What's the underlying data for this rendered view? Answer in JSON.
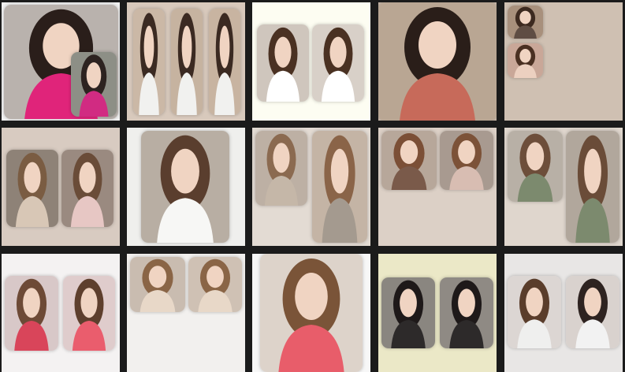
{
  "gallery": {
    "rows": [
      [
        {
          "bg": "#f2f2f2",
          "panels": [
            {
              "tone": "#b9b2ad",
              "accent": "#e0247a",
              "hair": "#2a1e1a"
            },
            {
              "tone": "#8d8f86",
              "accent": "#d12b82",
              "hair": "#2d2320"
            }
          ]
        },
        {
          "bg": "#d8c9bc",
          "panels": [
            {
              "tone": "#cbb8a6",
              "accent": "#f1f1ef",
              "hair": "#3b2a22"
            },
            {
              "tone": "#c6b3a0",
              "accent": "#f1f1ef",
              "hair": "#3b2a22"
            },
            {
              "tone": "#c8b4a1",
              "accent": "#f1f1ef",
              "hair": "#3b2a22"
            }
          ]
        },
        {
          "bg": "#fdfdf2",
          "panels": [
            {
              "tone": "#cfc6bd",
              "accent": "#ffffff",
              "hair": "#4a3122"
            },
            {
              "tone": "#d8d0c8",
              "accent": "#ffffff",
              "hair": "#4a3122"
            }
          ]
        },
        {
          "bg": "#c9b8a8",
          "panels": [
            {
              "tone": "#b9a693",
              "accent": "#c76a5a",
              "hair": "#2a1e19"
            }
          ]
        },
        {
          "bg": "#cfc0b2",
          "panels": [
            {
              "tone": "#a8907c",
              "accent": "#5f4d43",
              "hair": "#3d2a20"
            },
            {
              "tone": "#c9a798",
              "accent": "#ecd0c0",
              "hair": "#4a3022"
            }
          ]
        }
      ],
      [
        {
          "bg": "#d8cbc1",
          "panels": [
            {
              "tone": "#8e8277",
              "accent": "#d8c7b6",
              "hair": "#7a5c42"
            },
            {
              "tone": "#9a8a80",
              "accent": "#e7c7c4",
              "hair": "#6a4c38"
            }
          ]
        },
        {
          "bg": "#efefed",
          "panels": [
            {
              "tone": "#b8aea3",
              "accent": "#f7f7f5",
              "hair": "#5a3e2e"
            }
          ]
        },
        {
          "bg": "#e3dbd3",
          "panels": [
            {
              "tone": "#bdb0a4",
              "accent": "#c5b7a8",
              "hair": "#8b6a50"
            },
            {
              "tone": "#c4b4a5",
              "accent": "#a49a8f",
              "hair": "#8a6448"
            }
          ]
        },
        {
          "bg": "#dcd0c6",
          "panels": [
            {
              "tone": "#b7a79a",
              "accent": "#7a5a4a",
              "hair": "#7b4f36"
            },
            {
              "tone": "#a89a90",
              "accent": "#d8bdb2",
              "hair": "#7c5238"
            }
          ]
        },
        {
          "bg": "#dfd6cd",
          "panels": [
            {
              "tone": "#b8b0a6",
              "accent": "#7c8a6e",
              "hair": "#6d4e3a"
            },
            {
              "tone": "#b1a79c",
              "accent": "#7c8a6e",
              "hair": "#6a4c38"
            }
          ]
        }
      ],
      [
        {
          "bg": "#f4f2f2",
          "panels": [
            {
              "tone": "#d8c8c8",
              "accent": "#d9455a",
              "hair": "#6d4a36"
            },
            {
              "tone": "#dfcccc",
              "accent": "#ea5d6d",
              "hair": "#5e3f2d"
            }
          ]
        },
        {
          "bg": "#f2f0ee",
          "panels": [
            {
              "tone": "#c9bcb0",
              "accent": "#e8d8c8",
              "hair": "#8a6546"
            },
            {
              "tone": "#cfc1b4",
              "accent": "#e8d8c8",
              "hair": "#8a6546"
            }
          ]
        },
        {
          "bg": "#f7f7f7",
          "panels": [
            {
              "tone": "#ddd3ca",
              "accent": "#e85d6a",
              "hair": "#7a5438"
            }
          ]
        },
        {
          "bg": "#ebe8c7",
          "panels": [
            {
              "tone": "#8a8680",
              "accent": "#2d2a2a",
              "hair": "#1e1919"
            },
            {
              "tone": "#8f8a84",
              "accent": "#2d2a2a",
              "hair": "#1e1919"
            }
          ]
        },
        {
          "bg": "#e8e6e5",
          "panels": [
            {
              "tone": "#dcd6d3",
              "accent": "#efefee",
              "hair": "#5a3d2b"
            },
            {
              "tone": "#d9d2ce",
              "accent": "#f2f2f2",
              "hair": "#2e2320"
            }
          ]
        }
      ]
    ]
  }
}
